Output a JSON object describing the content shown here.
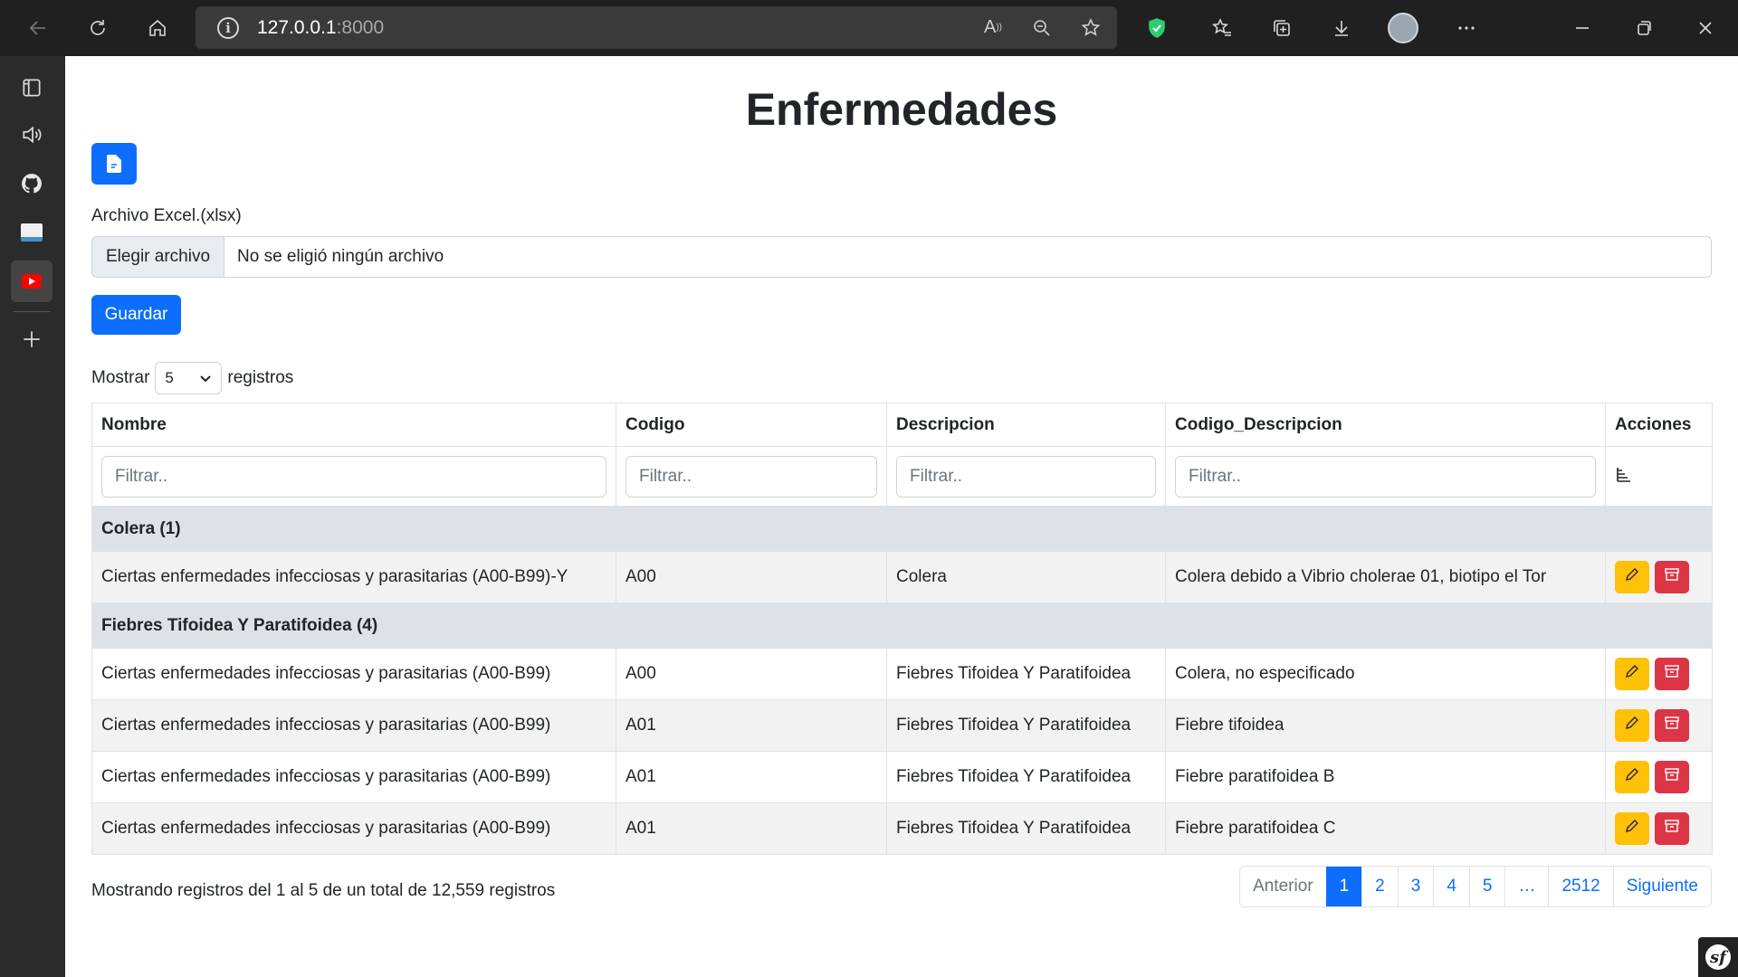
{
  "browser": {
    "url_host": "127.0.0.1",
    "url_port": ":8000"
  },
  "page": {
    "title": "Enfermedades",
    "file_label": "Archivo Excel.(xlsx)",
    "file_button": "Elegir archivo",
    "file_name": "No se eligió ningún archivo",
    "save_button": "Guardar",
    "length_prefix": "Mostrar",
    "length_value": "5",
    "length_suffix": "registros"
  },
  "table": {
    "headers": [
      "Nombre",
      "Codigo",
      "Descripcion",
      "Codigo_Descripcion",
      "Acciones"
    ],
    "filter_placeholder": "Filtrar..",
    "groups": [
      {
        "label": "Colera (1)",
        "rows": [
          [
            "Ciertas enfermedades infecciosas y parasitarias (A00-B99)-Y",
            "A00",
            "Colera",
            "Colera debido a Vibrio cholerae 01, biotipo el Tor"
          ]
        ]
      },
      {
        "label": "Fiebres Tifoidea Y Paratifoidea (4)",
        "rows": [
          [
            "Ciertas enfermedades infecciosas y parasitarias (A00-B99)",
            "A00",
            "Fiebres Tifoidea Y Paratifoidea",
            "Colera, no especificado"
          ],
          [
            "Ciertas enfermedades infecciosas y parasitarias (A00-B99)",
            "A01",
            "Fiebres Tifoidea Y Paratifoidea",
            "Fiebre tifoidea"
          ],
          [
            "Ciertas enfermedades infecciosas y parasitarias (A00-B99)",
            "A01",
            "Fiebres Tifoidea Y Paratifoidea",
            "Fiebre paratifoidea B"
          ],
          [
            "Ciertas enfermedades infecciosas y parasitarias (A00-B99)",
            "A01",
            "Fiebres Tifoidea Y Paratifoidea",
            "Fiebre paratifoidea C"
          ]
        ]
      }
    ]
  },
  "footer": {
    "info": "Mostrando registros del 1 al 5 de un total de 12,559 registros",
    "pagination": [
      "Anterior",
      "1",
      "2",
      "3",
      "4",
      "5",
      "…",
      "2512",
      "Siguiente"
    ],
    "active_page": "1"
  },
  "colors": {
    "primary": "#0d6efd",
    "warning": "#ffc107",
    "danger": "#dc3545"
  }
}
